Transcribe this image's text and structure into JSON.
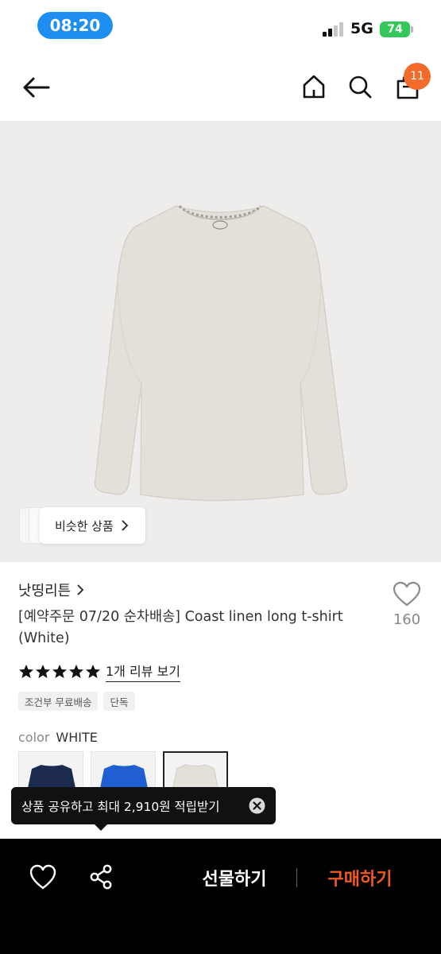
{
  "status_bar": {
    "time": "08:20",
    "network": "5G",
    "battery": "74"
  },
  "nav": {
    "cart_count": "11",
    "back_icon": "arrow-left-icon",
    "home_icon": "home-icon",
    "search_icon": "search-icon",
    "cart_icon": "shopping-bag-icon"
  },
  "product": {
    "image_alt": "ivory long-sleeve t-shirt",
    "similar_label": "비슷한 상품",
    "brand": "낫띵리튼",
    "title": "[예약주문 07/20 순차배송] Coast linen long t-shirt (White)",
    "like_count": "160",
    "rating_stars": 5,
    "review_link": "1개 리뷰 보기",
    "tags": [
      "조건부 무료배송",
      "단독"
    ],
    "color_label": "color",
    "color_value": "WHITE",
    "swatches": [
      {
        "name": "navy",
        "color": "#1b2a4e"
      },
      {
        "name": "blue",
        "color": "#1f5fd1"
      },
      {
        "name": "white",
        "color": "#ebe8e2",
        "selected": true
      }
    ]
  },
  "toast": {
    "message": "상품 공유하고 최대 2,910원 적립받기"
  },
  "bottom_bar": {
    "gift_label": "선물하기",
    "buy_label": "구매하기",
    "buy_color": "#f05a22"
  }
}
